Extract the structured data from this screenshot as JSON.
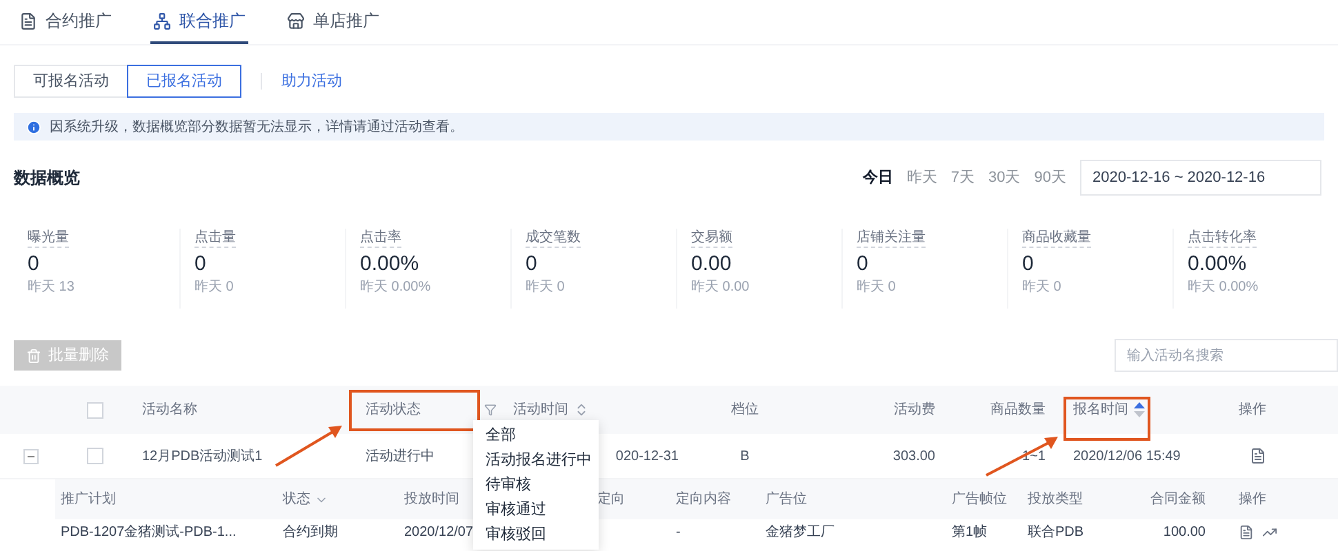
{
  "tabs": [
    {
      "label": "合约推广",
      "selected": false
    },
    {
      "label": "联合推广",
      "selected": true
    },
    {
      "label": "单店推广",
      "selected": false
    }
  ],
  "sub_tabs": [
    {
      "label": "可报名活动",
      "kind": "button",
      "selected": false
    },
    {
      "label": "已报名活动",
      "kind": "button",
      "selected": true
    },
    {
      "label": "助力活动",
      "kind": "link",
      "selected": false
    }
  ],
  "notice": "因系统升级，数据概览部分数据暂无法显示，详情请通过活动查看。",
  "overview": {
    "title": "数据概览",
    "ranges": [
      {
        "label": "今日",
        "selected": true
      },
      {
        "label": "昨天",
        "selected": false
      },
      {
        "label": "7天",
        "selected": false
      },
      {
        "label": "30天",
        "selected": false
      },
      {
        "label": "90天",
        "selected": false
      }
    ],
    "date_range": "2020-12-16 ~ 2020-12-16",
    "metrics": [
      {
        "label": "曝光量",
        "value": "0",
        "yesterday": "昨天 13"
      },
      {
        "label": "点击量",
        "value": "0",
        "yesterday": "昨天 0"
      },
      {
        "label": "点击率",
        "value": "0.00%",
        "yesterday": "昨天 0.00%"
      },
      {
        "label": "成交笔数",
        "value": "0",
        "yesterday": "昨天 0"
      },
      {
        "label": "交易额",
        "value": "0.00",
        "yesterday": "昨天 0.00"
      },
      {
        "label": "店铺关注量",
        "value": "0",
        "yesterday": "昨天 0"
      },
      {
        "label": "商品收藏量",
        "value": "0",
        "yesterday": "昨天 0"
      },
      {
        "label": "点击转化率",
        "value": "0.00%",
        "yesterday": "昨天 0.00%"
      }
    ]
  },
  "toolbar": {
    "batch_delete": {
      "label": "批量删除",
      "disabled": true
    },
    "search": {
      "placeholder": "输入活动名搜索"
    }
  },
  "table": {
    "select_all": {
      "checked": false
    },
    "columns": [
      {
        "label": "活动名称",
        "kind": "text"
      },
      {
        "label": "活动状态",
        "kind": "filter"
      },
      {
        "label": "活动时间",
        "kind": "sort",
        "sort_active": false
      },
      {
        "label": "档位",
        "kind": "text"
      },
      {
        "label": "活动费",
        "kind": "text"
      },
      {
        "label": "商品数量",
        "kind": "text"
      },
      {
        "label": "报名时间",
        "kind": "sort",
        "sort_active": true
      },
      {
        "label": "操作",
        "kind": "text"
      }
    ],
    "rows": [
      {
        "expanded": true,
        "checked": false,
        "cells": [
          "12月PDB活动测试1",
          "活动进行中",
          "020-12-31",
          "B",
          "303.00",
          "1~1",
          "2020/12/06 15:49"
        ]
      }
    ]
  },
  "sub_table": {
    "columns": [
      {
        "label": "推广计划",
        "kind": "text"
      },
      {
        "label": "状态",
        "kind": "dropdown"
      },
      {
        "label": "投放时间",
        "kind": "text"
      },
      {
        "label": "定向",
        "kind": "text"
      },
      {
        "label": "定向内容",
        "kind": "text"
      },
      {
        "label": "广告位",
        "kind": "text"
      },
      {
        "label": "广告帧位",
        "kind": "text"
      },
      {
        "label": "投放类型",
        "kind": "text"
      },
      {
        "label": "合同金额",
        "kind": "text"
      },
      {
        "label": "操作",
        "kind": "text"
      }
    ],
    "rows": [
      {
        "cells": [
          "PDB-1207金猪测试-PDB-1...",
          "合约到期",
          "2020/12/07",
          null,
          "-",
          "金猪梦工厂",
          "第1帧",
          "联合PDB",
          "100.00"
        ]
      }
    ]
  },
  "status_filter_menu": {
    "options": [
      "全部",
      "活动报名进行中",
      "待审核",
      "审核通过",
      "审核驳回"
    ]
  }
}
